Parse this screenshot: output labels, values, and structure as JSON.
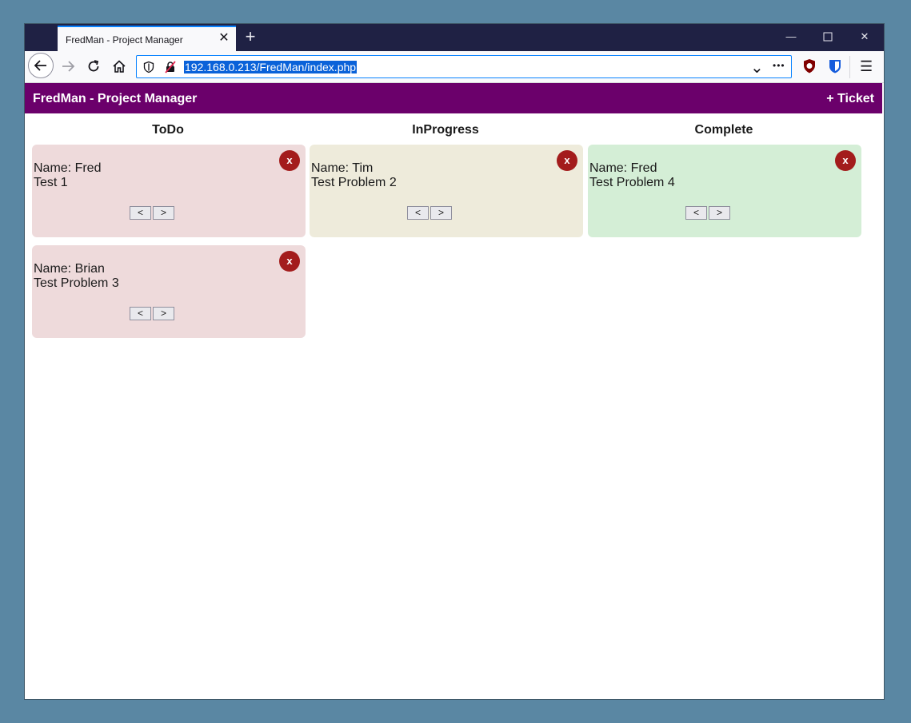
{
  "browser": {
    "tab_title": "FredMan - Project Manager",
    "tab_close_glyph": "✕",
    "new_tab_glyph": "+",
    "url": "192.168.0.213/FredMan/index.php",
    "more_glyph": "•••",
    "menu_glyph": "☰",
    "dropdown_glyph": "⌄",
    "minimize_glyph": "—",
    "close_glyph": "✕",
    "accent": "#0a84ff"
  },
  "app": {
    "title": "FredMan - Project Manager",
    "add_ticket_label": "+ Ticket",
    "header_color": "#6b006b",
    "columns": [
      {
        "label": "ToDo",
        "color": "#eedadb"
      },
      {
        "label": "InProgress",
        "color": "#eeebdb"
      },
      {
        "label": "Complete",
        "color": "#d4eed6"
      }
    ],
    "tickets": [
      {
        "column": "ToDo",
        "name": "Name: Fred",
        "description": "Test 1"
      },
      {
        "column": "ToDo",
        "name": "Name: Brian",
        "description": "Test Problem 3"
      },
      {
        "column": "InProgress",
        "name": "Name: Tim",
        "description": "Test Problem 2"
      },
      {
        "column": "Complete",
        "name": "Name: Fred",
        "description": "Test Problem 4"
      }
    ],
    "delete_label": "x",
    "move_left_label": "<",
    "move_right_label": ">"
  }
}
